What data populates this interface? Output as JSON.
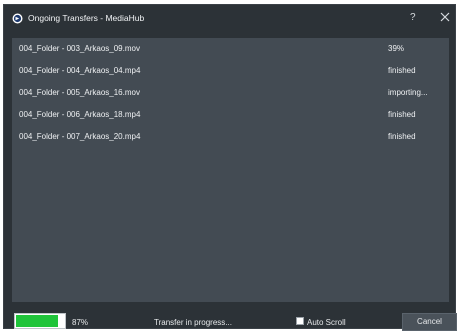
{
  "window": {
    "title": "Ongoing Transfers - MediaHub",
    "help_label": "?"
  },
  "transfers": [
    {
      "name": "004_Folder - 003_Arkaos_09.mov",
      "status": "39%"
    },
    {
      "name": "004_Folder - 004_Arkaos_04.mp4",
      "status": "finished"
    },
    {
      "name": "004_Folder - 005_Arkaos_16.mov",
      "status": "importing..."
    },
    {
      "name": "004_Folder - 006_Arkaos_18.mp4",
      "status": "finished"
    },
    {
      "name": "004_Folder - 007_Arkaos_20.mp4",
      "status": "finished"
    }
  ],
  "footer": {
    "progress_value": 0.87,
    "progress_text": "87%",
    "status_text": "Transfer in progress...",
    "auto_scroll_label": "Auto Scroll",
    "auto_scroll_checked": false,
    "cancel_label": "Cancel"
  },
  "icons": {
    "app": "mediahub-app-icon",
    "close": "close-icon",
    "help": "help-icon"
  },
  "colors": {
    "window_bg": "#2c3237",
    "list_bg": "#434b53",
    "progress_fill": "#1fc43a"
  }
}
